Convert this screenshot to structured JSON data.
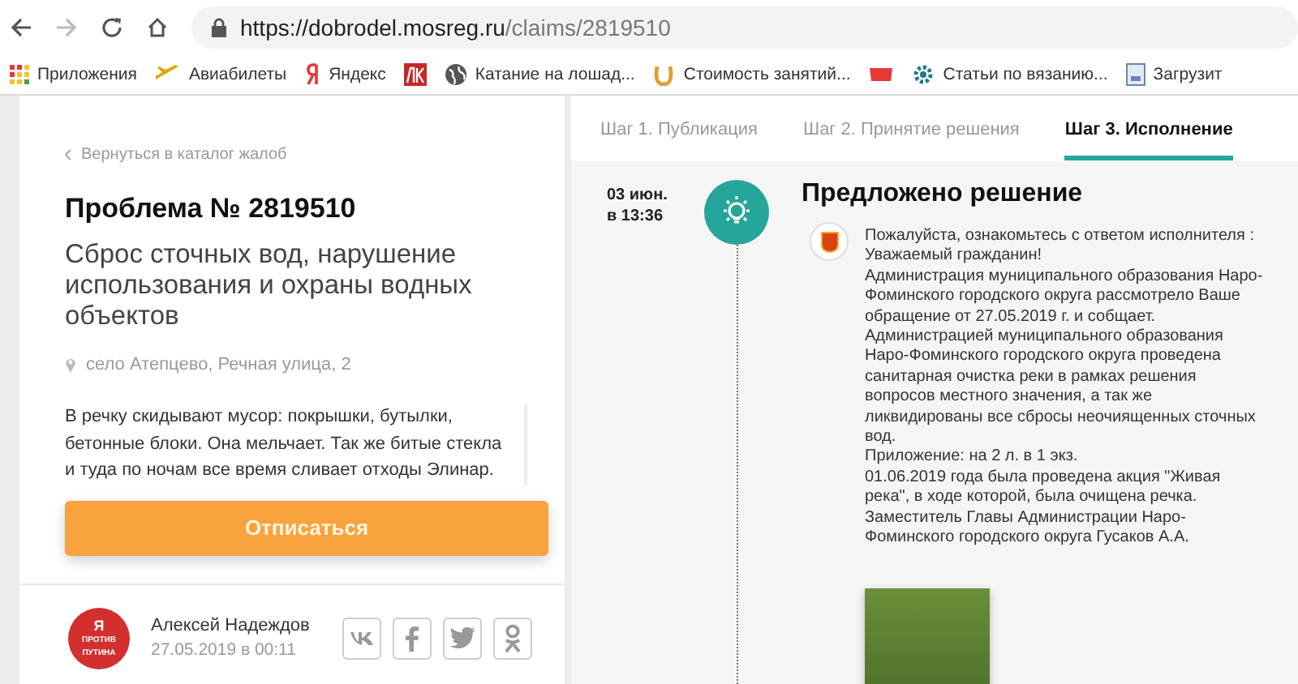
{
  "browser": {
    "url_host": "https://dobrodel.mosreg.ru",
    "url_path": "/claims/2819510",
    "bookmarks": [
      {
        "kind": "apps",
        "label": "Приложения"
      },
      {
        "kind": "plane",
        "label": "Авиабилеты"
      },
      {
        "kind": "ya",
        "label": "Яндекс"
      },
      {
        "kind": "lk"
      },
      {
        "kind": "globe",
        "label": "Катание на лошад..."
      },
      {
        "kind": "horseshoe",
        "label": "Стоимость занятий..."
      },
      {
        "kind": "pt"
      },
      {
        "kind": "gear",
        "label": "Статьи по вязанию..."
      },
      {
        "kind": "doc",
        "label": "Загрузит"
      }
    ]
  },
  "claim": {
    "back_link": "Вернуться в каталог жалоб",
    "title": "Проблема № 2819510",
    "subject": "Сброс сточных вод, нарушение использования и охраны водных объектов",
    "location": "село Атепцево, Речная улица, 2",
    "description": "В речку скидывают мусор: покрышки, бутылки, бетонные блоки. Она мельчает. Так же битые стекла и туда по ночам все время сливает отходы Элинар.",
    "unsubscribe_button": "Отписаться",
    "author": {
      "avatar_lines": [
        "Я",
        "ПРОТИВ",
        "ПУТИНА"
      ],
      "name": "Алексей Надеждов",
      "date": "27.05.2019 в 00:11"
    },
    "share": [
      {
        "kind": "vk"
      },
      {
        "kind": "facebook"
      },
      {
        "kind": "twitter"
      },
      {
        "kind": "ok"
      }
    ]
  },
  "steps": {
    "tabs": [
      {
        "label": "Шаг 1. Публикация",
        "selected": false
      },
      {
        "label": "Шаг 2. Принятие решения",
        "selected": false
      },
      {
        "label": "Шаг 3. Исполнение",
        "selected": true
      }
    ],
    "event": {
      "date": "03 июн.",
      "time": "в 13:36",
      "title": "Предложено решение",
      "message": "Пожалуйста, ознакомьтесь с ответом исполнителя :\nУважаемый гражданин!\nАдминистрация муниципального образования Наро-Фоминского городского округа рассмотрело Ваше обращение от 27.05.2019 г. и собщает.\nАдминистрацией муниципального образования Наро-Фоминского городского округа проведена санитарная очистка реки в рамках решения вопросов местного значения, а так же ликвидированы все сбросы неочиященных сточных вод.\nПриложение: на 2  л. в 1  экз.\n01.06.2019 года была проведена акция \"Живая река\", в ходе которой, была очищена речка.\nЗаместитель Главы Администрации Наро-Фоминского городского округа Гусаков А.А."
    }
  }
}
